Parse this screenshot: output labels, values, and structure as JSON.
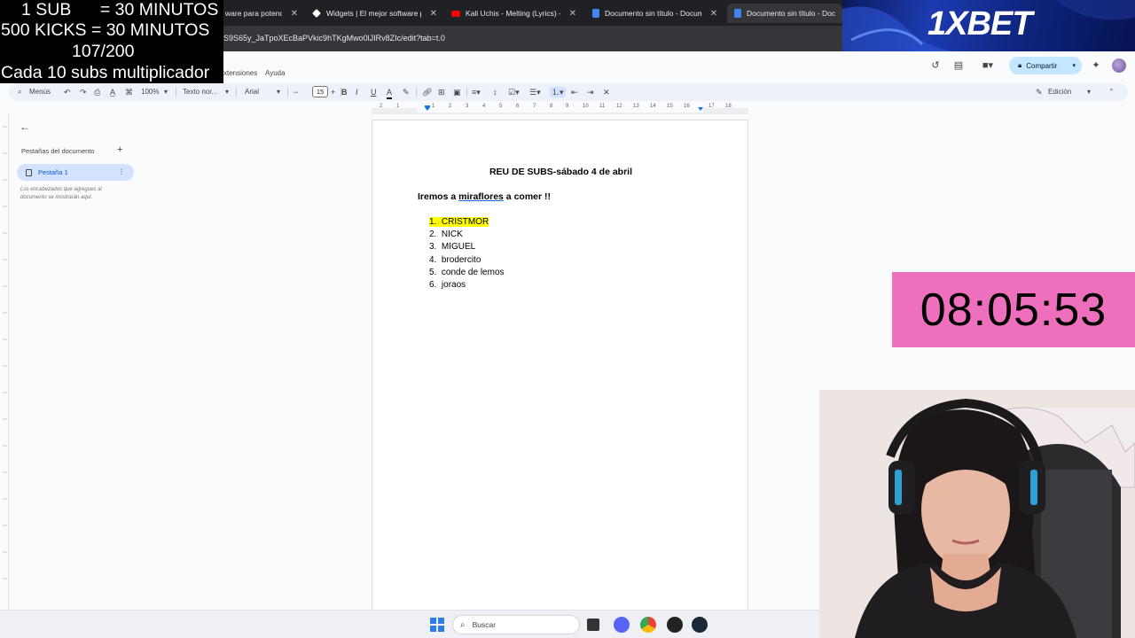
{
  "browser": {
    "tabs": [
      {
        "title": "ware para potencia",
        "icon": "generic-icon"
      },
      {
        "title": "Widgets | El mejor software pa",
        "icon": "widgets-icon"
      },
      {
        "title": "Kali Uchis - Melting (Lyrics) - Yo",
        "icon": "youtube-icon"
      },
      {
        "title": "Documento sin título - Docume",
        "icon": "docs-icon"
      },
      {
        "title": "Documento sin título - Docum",
        "icon": "docs-icon"
      }
    ],
    "url": "S9S65y_JaTpoXEcBaPVkic9hTKgMwo0lJIRv8ZIc/edit?tab=t.0"
  },
  "docs": {
    "menus": [
      "xtensiones",
      "Ayuda"
    ],
    "share_label": "Compartir",
    "mode_label": "Edición",
    "toolbar": {
      "menus_label": "Menús",
      "zoom": "100%",
      "style": "Texto nor...",
      "font": "Arial",
      "font_size": "15"
    }
  },
  "sidebar": {
    "title": "Pestañas del documento",
    "tab_label": "Pestaña 1",
    "hint": "Los encabezados que agregues al documento se mostrarán aquí."
  },
  "ruler": [
    "2",
    "1",
    "1",
    "2",
    "3",
    "4",
    "5",
    "6",
    "7",
    "8",
    "9",
    "10",
    "11",
    "12",
    "13",
    "14",
    "15",
    "16",
    "17",
    "18"
  ],
  "document": {
    "title": "REU DE SUBS-sábado 4 de abril",
    "subtitle_pre": "Iremos a ",
    "subtitle_link": "miraflores",
    "subtitle_post": " a comer !!",
    "list": [
      {
        "num": "1.",
        "text": "CRISTMOR"
      },
      {
        "num": "2.",
        "text": "NICK"
      },
      {
        "num": "3.",
        "text": "MIGUEL"
      },
      {
        "num": "4.",
        "text": "brodercito"
      },
      {
        "num": "5.",
        "text": "conde de lemos"
      },
      {
        "num": "6.",
        "text": "joraos"
      }
    ]
  },
  "taskbar": {
    "search_placeholder": "Buscar"
  },
  "overlay": {
    "line1": "1 SUB      = 30 MINUTOS",
    "line2": "500 KICKS = 30 MINUTOS",
    "line3": "107/200",
    "line4": "Cada 10 subs multiplicador",
    "brand": "1XBET",
    "timer": "08:05:53"
  },
  "colors": {
    "timer_bg": "#ef6fbf",
    "highlight": "#ffff00",
    "active_tab": "#d3e3fd",
    "share_bg": "#c2e7ff"
  }
}
